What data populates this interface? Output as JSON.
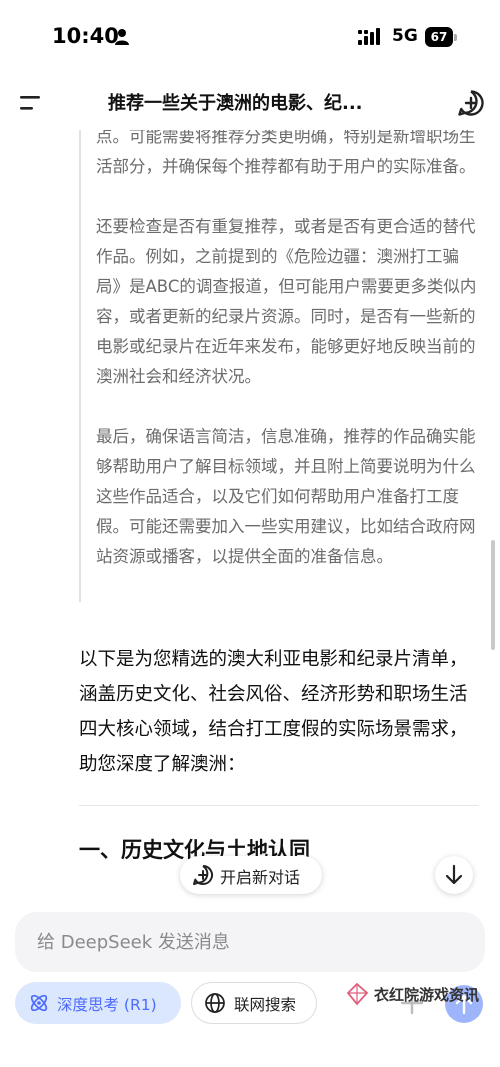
{
  "status_bar": {
    "time": "10:40",
    "network": "5G",
    "battery": "67"
  },
  "header": {
    "title": "推荐一些关于澳洲的电影、纪..."
  },
  "thinking": {
    "paragraphs": [
      "点。可能需要将推荐分类更明确，特别是新增职场生活部分，并确保每个推荐都有助于用户的实际准备。",
      "还要检查是否有重复推荐，或者是否有更合适的替代作品。例如，之前提到的《危险边疆：澳洲打工骗局》是ABC的调查报道，但可能用户需要更多类似内容，或者更新的纪录片资源。同时，是否有一些新的电影或纪录片在近年来发布，能够更好地反映当前的澳洲社会和经济状况。",
      "最后，确保语言简洁，信息准确，推荐的作品确实能够帮助用户了解目标领域，并且附上简要说明为什么这些作品适合，以及它们如何帮助用户准备打工度假。可能还需要加入一些实用建议，比如结合政府网站资源或播客，以提供全面的准备信息。"
    ]
  },
  "answer": {
    "intro": "以下是为您精选的澳大利亚电影和纪录片清单，涵盖历史文化、社会风俗、经济形势和职场生活四大核心领域，结合打工度假的实际场景需求，助您深度了解澳洲：",
    "section_heading": "一、历史文化与土地认同"
  },
  "floating": {
    "new_chat_label": "开启新对话"
  },
  "input": {
    "placeholder": "给 DeepSeek 发送消息",
    "value": ""
  },
  "controls": {
    "deep_think_label": "深度思考 (R1)",
    "web_search_label": "联网搜索"
  },
  "watermark": {
    "text": "衣红院游戏资讯"
  },
  "colors": {
    "accent": "#4d6bfe",
    "accent_bg": "#dbe7fd",
    "thinking_text": "#6b6b6b",
    "input_bg": "#f4f4f6"
  },
  "icons": {
    "person": "person-icon",
    "signal": "signal-icon",
    "menu": "menu-icon",
    "new_chat": "new-chat-icon",
    "scroll_down": "arrow-down-icon",
    "deep_think": "atom-icon",
    "web_search": "globe-icon",
    "attach": "plus-icon",
    "send": "arrow-up-icon"
  }
}
